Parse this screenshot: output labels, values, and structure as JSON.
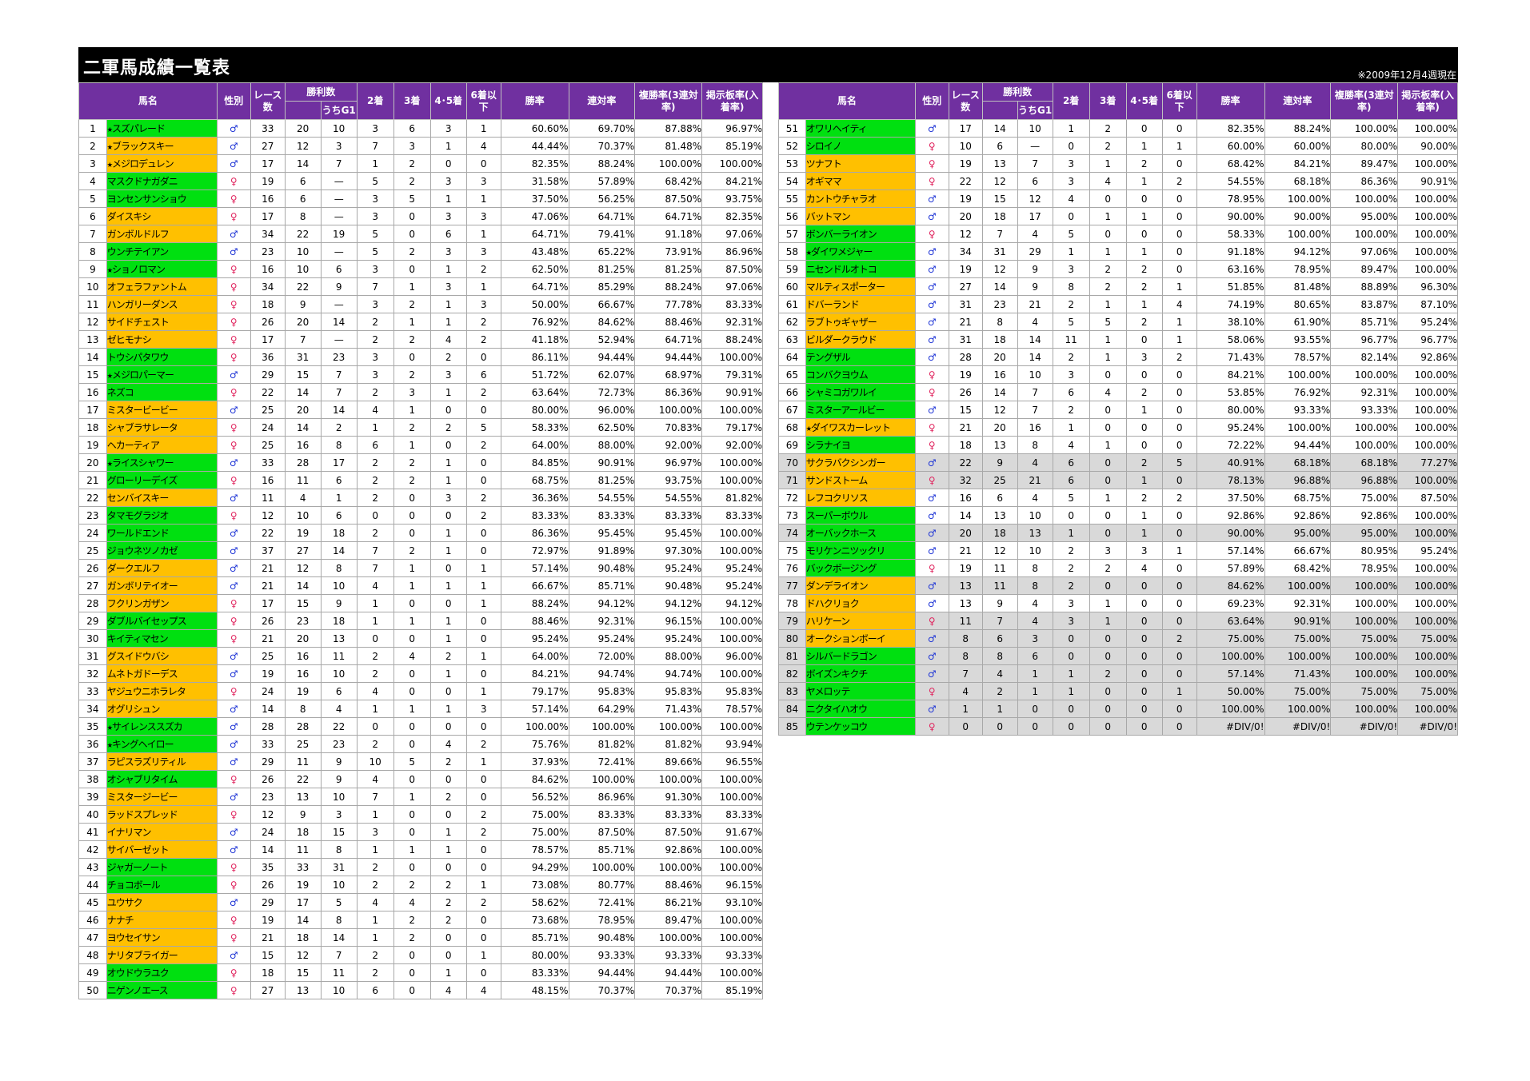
{
  "title": "二軍馬成績一覧表",
  "date_note": "※2009年12月4週現在",
  "headers": {
    "name": "馬名",
    "sex": "性別",
    "races": "レース数",
    "wins": "勝利数",
    "g1": "うちG1",
    "second": "2着",
    "third": "3着",
    "fourth_fifth": "4･5着",
    "sixth_below": "6着以下",
    "win_rate": "勝率",
    "place_rate": "連対率",
    "show_rate": "複勝率(3連対率)",
    "board_rate": "掲示板率(入着率)"
  },
  "colors": {
    "header_bg": "#7030a0",
    "name_orange": "#ffc000",
    "name_green": "#00e010",
    "row_gray": "#d9d9d9",
    "male": "#1f35d6",
    "female": "#e0245e"
  },
  "left_rows": [
    [
      "1",
      "★スズパレード",
      "♂",
      "33",
      "20",
      "10",
      "3",
      "6",
      "3",
      "1",
      "60.60%",
      "69.70%",
      "87.88%",
      "96.97%",
      "g",
      ""
    ],
    [
      "2",
      "★ブラックスキー",
      "♂",
      "27",
      "12",
      "3",
      "7",
      "3",
      "1",
      "4",
      "44.44%",
      "70.37%",
      "81.48%",
      "85.19%",
      "y",
      ""
    ],
    [
      "3",
      "★メジロデュレン",
      "♂",
      "17",
      "14",
      "7",
      "1",
      "2",
      "0",
      "0",
      "82.35%",
      "88.24%",
      "100.00%",
      "100.00%",
      "y",
      ""
    ],
    [
      "4",
      "マスクドナガダニ",
      "♀",
      "19",
      "6",
      "—",
      "5",
      "2",
      "3",
      "3",
      "31.58%",
      "57.89%",
      "68.42%",
      "84.21%",
      "g",
      ""
    ],
    [
      "5",
      "ヨンセンサンショウ",
      "♀",
      "16",
      "6",
      "—",
      "3",
      "5",
      "1",
      "1",
      "37.50%",
      "56.25%",
      "87.50%",
      "93.75%",
      "g",
      ""
    ],
    [
      "6",
      "ダイスキシ",
      "♀",
      "17",
      "8",
      "—",
      "3",
      "0",
      "3",
      "3",
      "47.06%",
      "64.71%",
      "64.71%",
      "82.35%",
      "y",
      ""
    ],
    [
      "7",
      "ガンボルドルフ",
      "♂",
      "34",
      "22",
      "19",
      "5",
      "0",
      "6",
      "1",
      "64.71%",
      "79.41%",
      "91.18%",
      "97.06%",
      "y",
      ""
    ],
    [
      "8",
      "ウンチテイアン",
      "♂",
      "23",
      "10",
      "—",
      "5",
      "2",
      "3",
      "3",
      "43.48%",
      "65.22%",
      "73.91%",
      "86.96%",
      "g",
      ""
    ],
    [
      "9",
      "★ショノロマン",
      "♀",
      "16",
      "10",
      "6",
      "3",
      "0",
      "1",
      "2",
      "62.50%",
      "81.25%",
      "81.25%",
      "87.50%",
      "g",
      ""
    ],
    [
      "10",
      "オフェラファントム",
      "♀",
      "34",
      "22",
      "9",
      "7",
      "1",
      "3",
      "1",
      "64.71%",
      "85.29%",
      "88.24%",
      "97.06%",
      "y",
      ""
    ],
    [
      "11",
      "ハンガリーダンス",
      "♀",
      "18",
      "9",
      "—",
      "3",
      "2",
      "1",
      "3",
      "50.00%",
      "66.67%",
      "77.78%",
      "83.33%",
      "y",
      ""
    ],
    [
      "12",
      "サイドチェスト",
      "♀",
      "26",
      "20",
      "14",
      "2",
      "1",
      "1",
      "2",
      "76.92%",
      "84.62%",
      "88.46%",
      "92.31%",
      "y",
      ""
    ],
    [
      "13",
      "ゼヒモナシ",
      "♀",
      "17",
      "7",
      "—",
      "2",
      "2",
      "4",
      "2",
      "41.18%",
      "52.94%",
      "64.71%",
      "88.24%",
      "y",
      ""
    ],
    [
      "14",
      "トウシパタワウ",
      "♀",
      "36",
      "31",
      "23",
      "3",
      "0",
      "2",
      "0",
      "86.11%",
      "94.44%",
      "94.44%",
      "100.00%",
      "g",
      ""
    ],
    [
      "15",
      "★メジロパーマー",
      "♂",
      "29",
      "15",
      "7",
      "3",
      "2",
      "3",
      "6",
      "51.72%",
      "62.07%",
      "68.97%",
      "79.31%",
      "g",
      ""
    ],
    [
      "16",
      "ネズコ",
      "♀",
      "22",
      "14",
      "7",
      "2",
      "3",
      "1",
      "2",
      "63.64%",
      "72.73%",
      "86.36%",
      "90.91%",
      "g",
      ""
    ],
    [
      "17",
      "ミスタービービー",
      "♂",
      "25",
      "20",
      "14",
      "4",
      "1",
      "0",
      "0",
      "80.00%",
      "96.00%",
      "100.00%",
      "100.00%",
      "y",
      ""
    ],
    [
      "18",
      "シャブラサレータ",
      "♀",
      "24",
      "14",
      "2",
      "1",
      "2",
      "2",
      "5",
      "58.33%",
      "62.50%",
      "70.83%",
      "79.17%",
      "y",
      ""
    ],
    [
      "19",
      "ヘカーティア",
      "♀",
      "25",
      "16",
      "8",
      "6",
      "1",
      "0",
      "2",
      "64.00%",
      "88.00%",
      "92.00%",
      "92.00%",
      "y",
      ""
    ],
    [
      "20",
      "★ライスシャワー",
      "♂",
      "33",
      "28",
      "17",
      "2",
      "2",
      "1",
      "0",
      "84.85%",
      "90.91%",
      "96.97%",
      "100.00%",
      "g",
      ""
    ],
    [
      "21",
      "グローリーデイズ",
      "♀",
      "16",
      "11",
      "6",
      "2",
      "2",
      "1",
      "0",
      "68.75%",
      "81.25%",
      "93.75%",
      "100.00%",
      "g",
      ""
    ],
    [
      "22",
      "センバイスキー",
      "♂",
      "11",
      "4",
      "1",
      "2",
      "0",
      "3",
      "2",
      "36.36%",
      "54.55%",
      "54.55%",
      "81.82%",
      "y",
      ""
    ],
    [
      "23",
      "タマモグラジオ",
      "♀",
      "12",
      "10",
      "6",
      "0",
      "0",
      "0",
      "2",
      "83.33%",
      "83.33%",
      "83.33%",
      "83.33%",
      "g",
      ""
    ],
    [
      "24",
      "ワールドエンド",
      "♂",
      "22",
      "19",
      "18",
      "2",
      "0",
      "1",
      "0",
      "86.36%",
      "95.45%",
      "95.45%",
      "100.00%",
      "g",
      ""
    ],
    [
      "25",
      "ジョウネツノカゼ",
      "♂",
      "37",
      "27",
      "14",
      "7",
      "2",
      "1",
      "0",
      "72.97%",
      "91.89%",
      "97.30%",
      "100.00%",
      "g",
      ""
    ],
    [
      "26",
      "ダークエルフ",
      "♂",
      "21",
      "12",
      "8",
      "7",
      "1",
      "0",
      "1",
      "57.14%",
      "90.48%",
      "95.24%",
      "95.24%",
      "y",
      ""
    ],
    [
      "27",
      "ガンボリテイオー",
      "♂",
      "21",
      "14",
      "10",
      "4",
      "1",
      "1",
      "1",
      "66.67%",
      "85.71%",
      "90.48%",
      "95.24%",
      "y",
      ""
    ],
    [
      "28",
      "フクリンガザン",
      "♀",
      "17",
      "15",
      "9",
      "1",
      "0",
      "0",
      "1",
      "88.24%",
      "94.12%",
      "94.12%",
      "94.12%",
      "y",
      ""
    ],
    [
      "29",
      "ダブルバイセップス",
      "♀",
      "26",
      "23",
      "18",
      "1",
      "1",
      "1",
      "0",
      "88.46%",
      "92.31%",
      "96.15%",
      "100.00%",
      "g",
      ""
    ],
    [
      "30",
      "キイティマセン",
      "♀",
      "21",
      "20",
      "13",
      "0",
      "0",
      "1",
      "0",
      "95.24%",
      "95.24%",
      "95.24%",
      "100.00%",
      "g",
      ""
    ],
    [
      "31",
      "グスイドウバシ",
      "♂",
      "25",
      "16",
      "11",
      "2",
      "4",
      "2",
      "1",
      "64.00%",
      "72.00%",
      "88.00%",
      "96.00%",
      "y",
      ""
    ],
    [
      "32",
      "ムネトガドーデス",
      "♂",
      "19",
      "16",
      "10",
      "2",
      "0",
      "1",
      "0",
      "84.21%",
      "94.74%",
      "94.74%",
      "100.00%",
      "y",
      ""
    ],
    [
      "33",
      "ヤジュウニホラレタ",
      "♀",
      "24",
      "19",
      "6",
      "4",
      "0",
      "0",
      "1",
      "79.17%",
      "95.83%",
      "95.83%",
      "95.83%",
      "y",
      ""
    ],
    [
      "34",
      "オグリシュン",
      "♂",
      "14",
      "8",
      "4",
      "1",
      "1",
      "1",
      "3",
      "57.14%",
      "64.29%",
      "71.43%",
      "78.57%",
      "y",
      ""
    ],
    [
      "35",
      "★サイレンススズカ",
      "♂",
      "28",
      "28",
      "22",
      "0",
      "0",
      "0",
      "0",
      "100.00%",
      "100.00%",
      "100.00%",
      "100.00%",
      "g",
      ""
    ],
    [
      "36",
      "★キングヘイロー",
      "♂",
      "33",
      "25",
      "23",
      "2",
      "0",
      "4",
      "2",
      "75.76%",
      "81.82%",
      "81.82%",
      "93.94%",
      "g",
      ""
    ],
    [
      "37",
      "ラピスラズリティル",
      "♂",
      "29",
      "11",
      "9",
      "10",
      "5",
      "2",
      "1",
      "37.93%",
      "72.41%",
      "89.66%",
      "96.55%",
      "y",
      ""
    ],
    [
      "38",
      "オシャブリタイム",
      "♀",
      "26",
      "22",
      "9",
      "4",
      "0",
      "0",
      "0",
      "84.62%",
      "100.00%",
      "100.00%",
      "100.00%",
      "g",
      ""
    ],
    [
      "39",
      "ミスタージービー",
      "♂",
      "23",
      "13",
      "10",
      "7",
      "1",
      "2",
      "0",
      "56.52%",
      "86.96%",
      "91.30%",
      "100.00%",
      "y",
      ""
    ],
    [
      "40",
      "ラッドスプレッド",
      "♀",
      "12",
      "9",
      "3",
      "1",
      "0",
      "0",
      "2",
      "75.00%",
      "83.33%",
      "83.33%",
      "83.33%",
      "y",
      ""
    ],
    [
      "41",
      "イナリマン",
      "♂",
      "24",
      "18",
      "15",
      "3",
      "0",
      "1",
      "2",
      "75.00%",
      "87.50%",
      "87.50%",
      "91.67%",
      "y",
      ""
    ],
    [
      "42",
      "サイバーゼット",
      "♂",
      "14",
      "11",
      "8",
      "1",
      "1",
      "1",
      "0",
      "78.57%",
      "85.71%",
      "92.86%",
      "100.00%",
      "y",
      ""
    ],
    [
      "43",
      "ジャガーノート",
      "♀",
      "35",
      "33",
      "31",
      "2",
      "0",
      "0",
      "0",
      "94.29%",
      "100.00%",
      "100.00%",
      "100.00%",
      "g",
      ""
    ],
    [
      "44",
      "チョコボール",
      "♀",
      "26",
      "19",
      "10",
      "2",
      "2",
      "2",
      "1",
      "73.08%",
      "80.77%",
      "88.46%",
      "96.15%",
      "g",
      ""
    ],
    [
      "45",
      "ユウサク",
      "♂",
      "29",
      "17",
      "5",
      "4",
      "4",
      "2",
      "2",
      "58.62%",
      "72.41%",
      "86.21%",
      "93.10%",
      "y",
      ""
    ],
    [
      "46",
      "ナナチ",
      "♀",
      "19",
      "14",
      "8",
      "1",
      "2",
      "2",
      "0",
      "73.68%",
      "78.95%",
      "89.47%",
      "100.00%",
      "y",
      ""
    ],
    [
      "47",
      "ヨウセイサン",
      "♀",
      "21",
      "18",
      "14",
      "1",
      "2",
      "0",
      "0",
      "85.71%",
      "90.48%",
      "100.00%",
      "100.00%",
      "y",
      ""
    ],
    [
      "48",
      "ナリタブライガー",
      "♂",
      "15",
      "12",
      "7",
      "2",
      "0",
      "0",
      "1",
      "80.00%",
      "93.33%",
      "93.33%",
      "93.33%",
      "y",
      ""
    ],
    [
      "49",
      "オウドウラユク",
      "♀",
      "18",
      "15",
      "11",
      "2",
      "0",
      "1",
      "0",
      "83.33%",
      "94.44%",
      "94.44%",
      "100.00%",
      "g",
      ""
    ],
    [
      "50",
      "ニゲンノエース",
      "♀",
      "27",
      "13",
      "10",
      "6",
      "0",
      "4",
      "4",
      "48.15%",
      "70.37%",
      "70.37%",
      "85.19%",
      "g",
      ""
    ]
  ],
  "right_rows": [
    [
      "51",
      "オワリヘイティ",
      "♂",
      "17",
      "14",
      "10",
      "1",
      "2",
      "0",
      "0",
      "82.35%",
      "88.24%",
      "100.00%",
      "100.00%",
      "g",
      ""
    ],
    [
      "52",
      "シロイノ",
      "♀",
      "10",
      "6",
      "—",
      "0",
      "2",
      "1",
      "1",
      "60.00%",
      "60.00%",
      "80.00%",
      "90.00%",
      "g",
      ""
    ],
    [
      "53",
      "ツナフト",
      "♀",
      "19",
      "13",
      "7",
      "3",
      "1",
      "2",
      "0",
      "68.42%",
      "84.21%",
      "89.47%",
      "100.00%",
      "y",
      ""
    ],
    [
      "54",
      "オギママ",
      "♀",
      "22",
      "12",
      "6",
      "3",
      "4",
      "1",
      "2",
      "54.55%",
      "68.18%",
      "86.36%",
      "90.91%",
      "y",
      ""
    ],
    [
      "55",
      "カントウチャラオ",
      "♂",
      "19",
      "15",
      "12",
      "4",
      "0",
      "0",
      "0",
      "78.95%",
      "100.00%",
      "100.00%",
      "100.00%",
      "y",
      ""
    ],
    [
      "56",
      "バットマン",
      "♂",
      "20",
      "18",
      "17",
      "0",
      "1",
      "1",
      "0",
      "90.00%",
      "90.00%",
      "95.00%",
      "100.00%",
      "y",
      ""
    ],
    [
      "57",
      "ボンバーライオン",
      "♀",
      "12",
      "7",
      "4",
      "5",
      "0",
      "0",
      "0",
      "58.33%",
      "100.00%",
      "100.00%",
      "100.00%",
      "g",
      ""
    ],
    [
      "58",
      "★ダイワメジャー",
      "♂",
      "34",
      "31",
      "29",
      "1",
      "1",
      "1",
      "0",
      "91.18%",
      "94.12%",
      "97.06%",
      "100.00%",
      "g",
      ""
    ],
    [
      "59",
      "ニセンドルオトコ",
      "♂",
      "19",
      "12",
      "9",
      "3",
      "2",
      "2",
      "0",
      "63.16%",
      "78.95%",
      "89.47%",
      "100.00%",
      "g",
      ""
    ],
    [
      "60",
      "マルティスポーター",
      "♂",
      "27",
      "14",
      "9",
      "8",
      "2",
      "2",
      "1",
      "51.85%",
      "81.48%",
      "88.89%",
      "96.30%",
      "y",
      ""
    ],
    [
      "61",
      "ドバーランド",
      "♂",
      "31",
      "23",
      "21",
      "2",
      "1",
      "1",
      "4",
      "74.19%",
      "80.65%",
      "83.87%",
      "87.10%",
      "y",
      ""
    ],
    [
      "62",
      "ラブトゥギャザー",
      "♂",
      "21",
      "8",
      "4",
      "5",
      "5",
      "2",
      "1",
      "38.10%",
      "61.90%",
      "85.71%",
      "95.24%",
      "y",
      ""
    ],
    [
      "63",
      "ビルダークラウド",
      "♂",
      "31",
      "18",
      "14",
      "11",
      "1",
      "0",
      "1",
      "58.06%",
      "93.55%",
      "96.77%",
      "96.77%",
      "y",
      ""
    ],
    [
      "64",
      "テングザル",
      "♂",
      "28",
      "20",
      "14",
      "2",
      "1",
      "3",
      "2",
      "71.43%",
      "78.57%",
      "82.14%",
      "92.86%",
      "g",
      ""
    ],
    [
      "65",
      "コンバクヨウム",
      "♀",
      "19",
      "16",
      "10",
      "3",
      "0",
      "0",
      "0",
      "84.21%",
      "100.00%",
      "100.00%",
      "100.00%",
      "g",
      ""
    ],
    [
      "66",
      "シャミコガワルイ",
      "♀",
      "26",
      "14",
      "7",
      "6",
      "4",
      "2",
      "0",
      "53.85%",
      "76.92%",
      "92.31%",
      "100.00%",
      "g",
      ""
    ],
    [
      "67",
      "ミスターアールビー",
      "♂",
      "15",
      "12",
      "7",
      "2",
      "0",
      "1",
      "0",
      "80.00%",
      "93.33%",
      "93.33%",
      "100.00%",
      "g",
      ""
    ],
    [
      "68",
      "★ダイワスカーレット",
      "♀",
      "21",
      "20",
      "16",
      "1",
      "0",
      "0",
      "0",
      "95.24%",
      "100.00%",
      "100.00%",
      "100.00%",
      "y",
      ""
    ],
    [
      "69",
      "シラナイヨ",
      "♀",
      "18",
      "13",
      "8",
      "4",
      "1",
      "0",
      "0",
      "72.22%",
      "94.44%",
      "100.00%",
      "100.00%",
      "g",
      ""
    ],
    [
      "70",
      "サクラバクシンガー",
      "♂",
      "22",
      "9",
      "4",
      "6",
      "0",
      "2",
      "5",
      "40.91%",
      "68.18%",
      "68.18%",
      "77.27%",
      "y",
      "gr"
    ],
    [
      "71",
      "サンドストーム",
      "♀",
      "32",
      "25",
      "21",
      "6",
      "0",
      "1",
      "0",
      "78.13%",
      "96.88%",
      "96.88%",
      "100.00%",
      "y",
      "gr"
    ],
    [
      "72",
      "レフコクリソス",
      "♂",
      "16",
      "6",
      "4",
      "5",
      "1",
      "2",
      "2",
      "37.50%",
      "68.75%",
      "75.00%",
      "87.50%",
      "y",
      ""
    ],
    [
      "73",
      "スーパーボウル",
      "♂",
      "14",
      "13",
      "10",
      "0",
      "0",
      "1",
      "0",
      "92.86%",
      "92.86%",
      "92.86%",
      "100.00%",
      "g",
      ""
    ],
    [
      "74",
      "オーバックホース",
      "♂",
      "20",
      "18",
      "13",
      "1",
      "0",
      "1",
      "0",
      "90.00%",
      "95.00%",
      "95.00%",
      "100.00%",
      "g",
      "gr"
    ],
    [
      "75",
      "モリケンニツックリ",
      "♂",
      "21",
      "12",
      "10",
      "2",
      "3",
      "3",
      "1",
      "57.14%",
      "66.67%",
      "80.95%",
      "95.24%",
      "g",
      ""
    ],
    [
      "76",
      "バックボージング",
      "♀",
      "19",
      "11",
      "8",
      "2",
      "2",
      "4",
      "0",
      "57.89%",
      "68.42%",
      "78.95%",
      "100.00%",
      "g",
      ""
    ],
    [
      "77",
      "ダンデライオン",
      "♂",
      "13",
      "11",
      "8",
      "2",
      "0",
      "0",
      "0",
      "84.62%",
      "100.00%",
      "100.00%",
      "100.00%",
      "y",
      "gr"
    ],
    [
      "78",
      "ドハクリョク",
      "♂",
      "13",
      "9",
      "4",
      "3",
      "1",
      "0",
      "0",
      "69.23%",
      "92.31%",
      "100.00%",
      "100.00%",
      "y",
      ""
    ],
    [
      "79",
      "ハリケーン",
      "♀",
      "11",
      "7",
      "4",
      "3",
      "1",
      "0",
      "0",
      "63.64%",
      "90.91%",
      "100.00%",
      "100.00%",
      "y",
      "gr"
    ],
    [
      "80",
      "オークションボーイ",
      "♂",
      "8",
      "6",
      "3",
      "0",
      "0",
      "0",
      "2",
      "75.00%",
      "75.00%",
      "75.00%",
      "75.00%",
      "y",
      "gr"
    ],
    [
      "81",
      "シルバードラゴン",
      "♂",
      "8",
      "8",
      "6",
      "0",
      "0",
      "0",
      "0",
      "100.00%",
      "100.00%",
      "100.00%",
      "100.00%",
      "g",
      "gr"
    ],
    [
      "82",
      "ボイズンキクチ",
      "♂",
      "7",
      "4",
      "1",
      "1",
      "2",
      "0",
      "0",
      "57.14%",
      "71.43%",
      "100.00%",
      "100.00%",
      "g",
      "gr"
    ],
    [
      "83",
      "ヤメロッテ",
      "♀",
      "4",
      "2",
      "1",
      "1",
      "0",
      "0",
      "1",
      "50.00%",
      "75.00%",
      "75.00%",
      "75.00%",
      "g",
      "gr"
    ],
    [
      "84",
      "ニクタイハオウ",
      "♂",
      "1",
      "1",
      "0",
      "0",
      "0",
      "0",
      "0",
      "100.00%",
      "100.00%",
      "100.00%",
      "100.00%",
      "g",
      "gr"
    ],
    [
      "85",
      "ウテンケッコウ",
      "♀",
      "0",
      "0",
      "0",
      "0",
      "0",
      "0",
      "0",
      "#DIV/0!",
      "#DIV/0!",
      "#DIV/0!",
      "#DIV/0!",
      "g",
      "gr"
    ]
  ]
}
